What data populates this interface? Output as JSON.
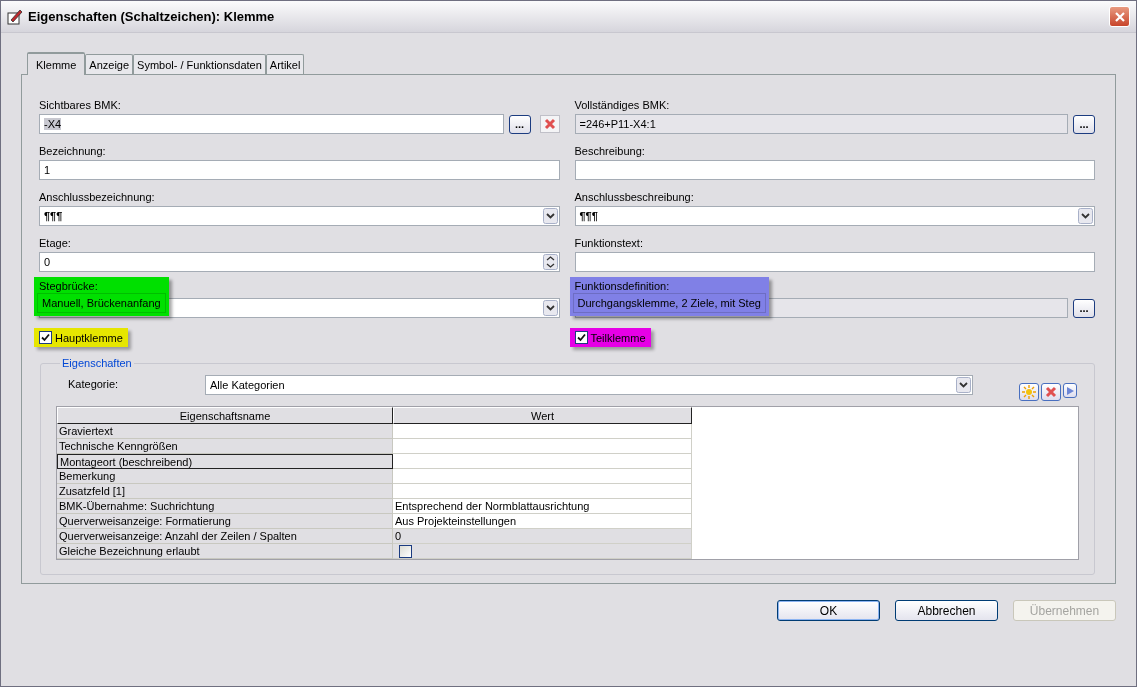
{
  "window": {
    "title": "Eigenschaften (Schaltzeichen): Klemme"
  },
  "tabs": [
    {
      "label": "Klemme",
      "selected": true
    },
    {
      "label": "Anzeige",
      "selected": false
    },
    {
      "label": "Symbol- / Funktionsdaten",
      "selected": false
    },
    {
      "label": "Artikel",
      "selected": false
    }
  ],
  "fields": [
    {
      "label": "Sichtbares BMK:",
      "value": "-X4",
      "value_selected": true,
      "kind": "text_browse_delete",
      "button": "..."
    },
    {
      "label": "Vollständiges BMK:",
      "value": "=246+P11-X4:1",
      "kind": "readonly_browse",
      "button": "..."
    },
    {
      "label": "Bezeichnung:",
      "value": "1",
      "kind": "text"
    },
    {
      "label": "Beschreibung:",
      "kind": "text"
    },
    {
      "label": "Anschlussbezeichnung:",
      "value": "¶¶¶",
      "kind": "combo"
    },
    {
      "label": "Anschlussbeschreibung:",
      "value": "¶¶¶",
      "kind": "combo"
    },
    {
      "label": "Etage:",
      "value": "0",
      "kind": "spin"
    },
    {
      "label": "Funktionstext:",
      "kind": "text"
    },
    {
      "label": "Stegbrücke:",
      "value": "Manuell, Brückenanfang",
      "kind": "combo",
      "color": "#00e000"
    },
    {
      "label": "Funktionsdefinition:",
      "value": "Durchgangsklemme, 2 Ziele, mit Steg",
      "kind": "readonly_browse",
      "button": "...",
      "color": "#8080e6"
    }
  ],
  "checkboxes": [
    {
      "label": "Hauptklemme",
      "checked": true,
      "color": "#e6e600"
    },
    {
      "label": "Teilklemme",
      "checked": true,
      "color": "#e600e6"
    }
  ],
  "group": {
    "title": "Eigenschaften",
    "category_label": "Kategorie:",
    "category_value": "Alle Kategorien",
    "table": {
      "columns": [
        "Eigenschaftsname",
        "Wert"
      ],
      "rows": [
        {
          "name": "Graviertext",
          "kind": "text",
          "readonly": false,
          "focused": false
        },
        {
          "name": "Technische Kenngrößen",
          "kind": "text",
          "readonly": false,
          "focused": false
        },
        {
          "name": "Montageort (beschreibend)",
          "kind": "text",
          "readonly": false,
          "focused": true
        },
        {
          "name": "Bemerkung",
          "kind": "text",
          "readonly": false,
          "focused": false
        },
        {
          "name": "Zusatzfeld [1]",
          "kind": "text",
          "readonly": false,
          "focused": false
        },
        {
          "name": "BMK-Übernahme: Suchrichtung",
          "value": "Entsprechend der Normblattausrichtung",
          "kind": "text",
          "readonly": false,
          "focused": false
        },
        {
          "name": "Querverweisanzeige: Formatierung",
          "value": "Aus Projekteinstellungen",
          "kind": "text",
          "readonly": false,
          "focused": false
        },
        {
          "name": "Querverweisanzeige: Anzahl der Zeilen / Spalten",
          "value": "0",
          "kind": "text",
          "readonly": true,
          "focused": false
        },
        {
          "name": "Gleiche Bezeichnung erlaubt",
          "kind": "checkbox",
          "checked": false,
          "readonly": true,
          "focused": false
        }
      ]
    }
  },
  "buttons": [
    {
      "label": "OK",
      "default": true,
      "disabled": false
    },
    {
      "label": "Abbrechen",
      "default": false,
      "disabled": false
    },
    {
      "label": "Übernehmen",
      "default": false,
      "disabled": true
    }
  ]
}
